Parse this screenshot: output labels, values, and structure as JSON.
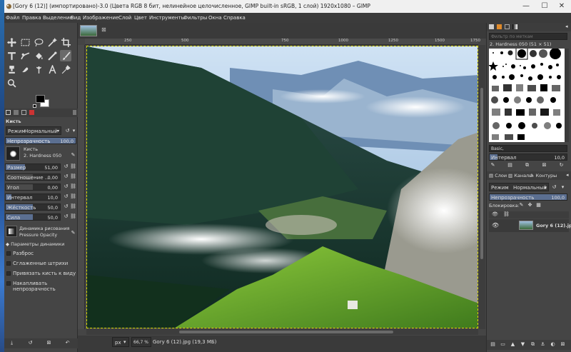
{
  "window": {
    "title": "[Gory 6 (12)] (импортировано)-3.0 (Цвета RGB 8 бит, нелинейное целочисленное, GIMP built-in sRGB, 1 слой) 1920x1080 – GIMP",
    "minimize": "—",
    "maximize": "☐",
    "close": "✕"
  },
  "menu": [
    "Файл",
    "Правка",
    "Выделение",
    "Вид",
    "Изображение",
    "Слой",
    "Цвет",
    "Инструменты",
    "Фильтры",
    "Окна",
    "Справка"
  ],
  "tool_options": {
    "title": "Кисть",
    "mode_label": "Режим",
    "mode_value": "Нормальный",
    "opacity_label": "Непрозрачность",
    "opacity_value": "100,0",
    "brush_label": "Кисть",
    "brush_value": "2. Hardness 050",
    "size_label": "Размер",
    "size_value": "51,00",
    "aspect_label": "Соотношение ...",
    "aspect_value": "0,00",
    "angle_label": "Угол",
    "angle_value": "0,00",
    "spacing_label": "Интервал",
    "spacing_value": "10,0",
    "hardness_label": "Жёсткость",
    "hardness_value": "50,0",
    "force_label": "Сила",
    "force_value": "50,0",
    "dynamics_label": "Динамика рисования",
    "dynamics_value": "Pressure Opacity",
    "dynamics_params": "Параметры динамики",
    "jitter": "Разброс",
    "smooth": "Сглаженные штрихи",
    "lock_brush": "Привязать кисть к виду",
    "incremental": "Накапливать непрозрачность"
  },
  "ruler_marks": [
    "250",
    "500",
    "750",
    "1000",
    "1250",
    "1500",
    "1750"
  ],
  "status": {
    "unit": "px",
    "zoom": "66,7 %",
    "file": "Gory 6 (12).jpg (19,3 МБ)"
  },
  "brushes": {
    "filter_placeholder": "Фильтр по меткам",
    "current": "2. Hardness 050 (51 × 51)",
    "tag": "Basic,",
    "spacing_label": "Интервал",
    "spacing_value": "10,0"
  },
  "layers": {
    "tabs": [
      "Слои",
      "Каналы",
      "Контуры"
    ],
    "mode_label": "Режим",
    "mode_value": "Нормальный",
    "opacity_label": "Непрозрачность",
    "opacity_value": "100,0",
    "lock_label": "Блокировка:",
    "layer_name": "Gory 6 (12).jpg"
  },
  "colors": {
    "fg": "#000000",
    "bg": "#ffffff",
    "accent": "#5b6f91"
  }
}
